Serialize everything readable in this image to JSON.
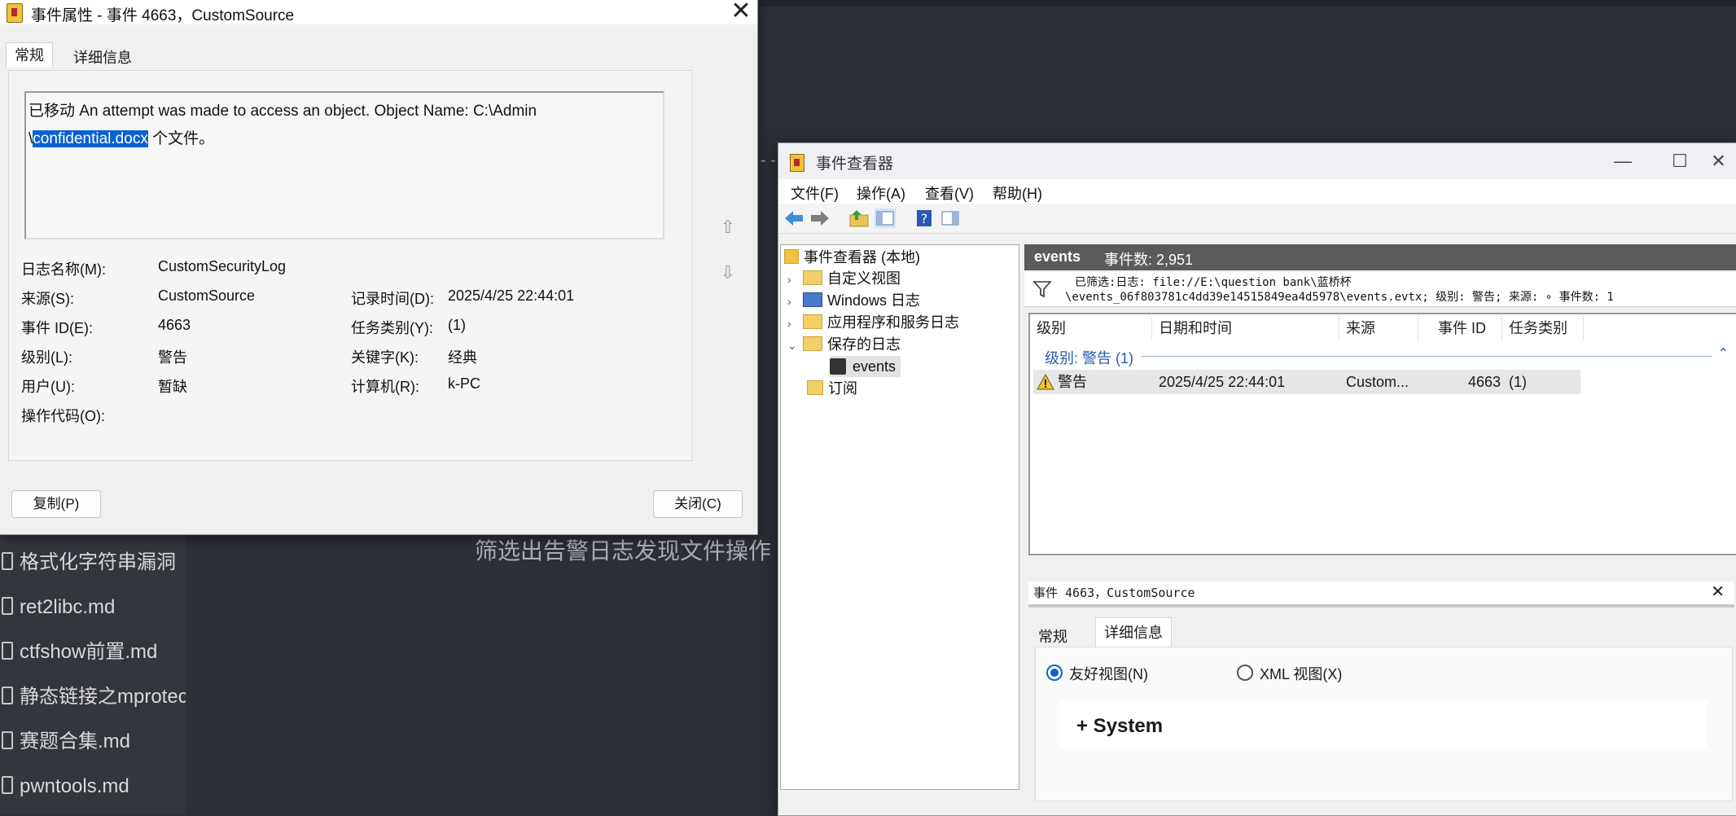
{
  "background": {
    "files": [
      "格式化字符串漏洞",
      "ret2libc.md",
      "ctfshow前置.md",
      "静态链接之mprotect",
      "赛题合集.md",
      "pwntools.md"
    ],
    "caption": "筛选出告警日志发现文件操作",
    "dashes": "- -"
  },
  "properties_dialog": {
    "title": "事件属性 - 事件 4663，CustomSource",
    "close": "✕",
    "tabs": [
      "常规",
      "详细信息"
    ],
    "message_line1": "已移动 An attempt was made to access an object. Object Name: C:\\Admin",
    "message_line2_prefix": "\\",
    "message_selected": "confidential.docx",
    "message_line2_suffix": " 个文件。",
    "fields": {
      "log_name_label": "日志名称(M):",
      "log_name": "CustomSecurityLog",
      "source_label": "来源(S):",
      "source": "CustomSource",
      "logged_label": "记录时间(D):",
      "logged": "2025/4/25 22:44:01",
      "event_id_label": "事件 ID(E):",
      "event_id": "4663",
      "task_label": "任务类别(Y):",
      "task": "(1)",
      "level_label": "级别(L):",
      "level": "警告",
      "keywords_label": "关键字(K):",
      "keywords": "经典",
      "user_label": "用户(U):",
      "user": "暂缺",
      "computer_label": "计算机(R):",
      "computer": "k-PC",
      "opcode_label": "操作代码(O):"
    },
    "copy_button": "复制(P)",
    "close_button": "关闭(C)"
  },
  "event_viewer": {
    "title": "事件查看器",
    "window_buttons": [
      "—",
      "☐",
      "✕"
    ],
    "menu": [
      "文件(F)",
      "操作(A)",
      "查看(V)",
      "帮助(H)"
    ],
    "tree": {
      "root": "事件查看器 (本地)",
      "items": [
        "自定义视图",
        "Windows 日志",
        "应用程序和服务日志",
        "保存的日志"
      ],
      "events": "events",
      "subscriptions": "订阅"
    },
    "header": {
      "name": "events",
      "count": "事件数: 2,951"
    },
    "filter_line1": "已筛选:日志: file://E:\\question bank\\蓝桥杯",
    "filter_line2": "\\events_06f803781c4dd39e14515849ea4d5978\\events.evtx; 级别: 警告; 来源: ∘ 事件数: 1",
    "columns": [
      "级别",
      "日期和时间",
      "来源",
      "事件 ID",
      "任务类别"
    ],
    "group_label": "级别: 警告 (1)",
    "row": {
      "level": "警告",
      "datetime": "2025/4/25 22:44:01",
      "source": "Custom...",
      "event_id": "4663",
      "task": "(1)"
    },
    "detail": {
      "title": "事件 4663，CustomSource",
      "close": "✕",
      "tabs": [
        "常规",
        "详细信息"
      ],
      "friendly_view": "友好视图(N)",
      "xml_view": "XML 视图(X)",
      "system": "+ System"
    },
    "colors": {
      "header_bg": "#5b5b5b",
      "selection": "#0a62d0",
      "group_text": "#2a5db0"
    }
  }
}
